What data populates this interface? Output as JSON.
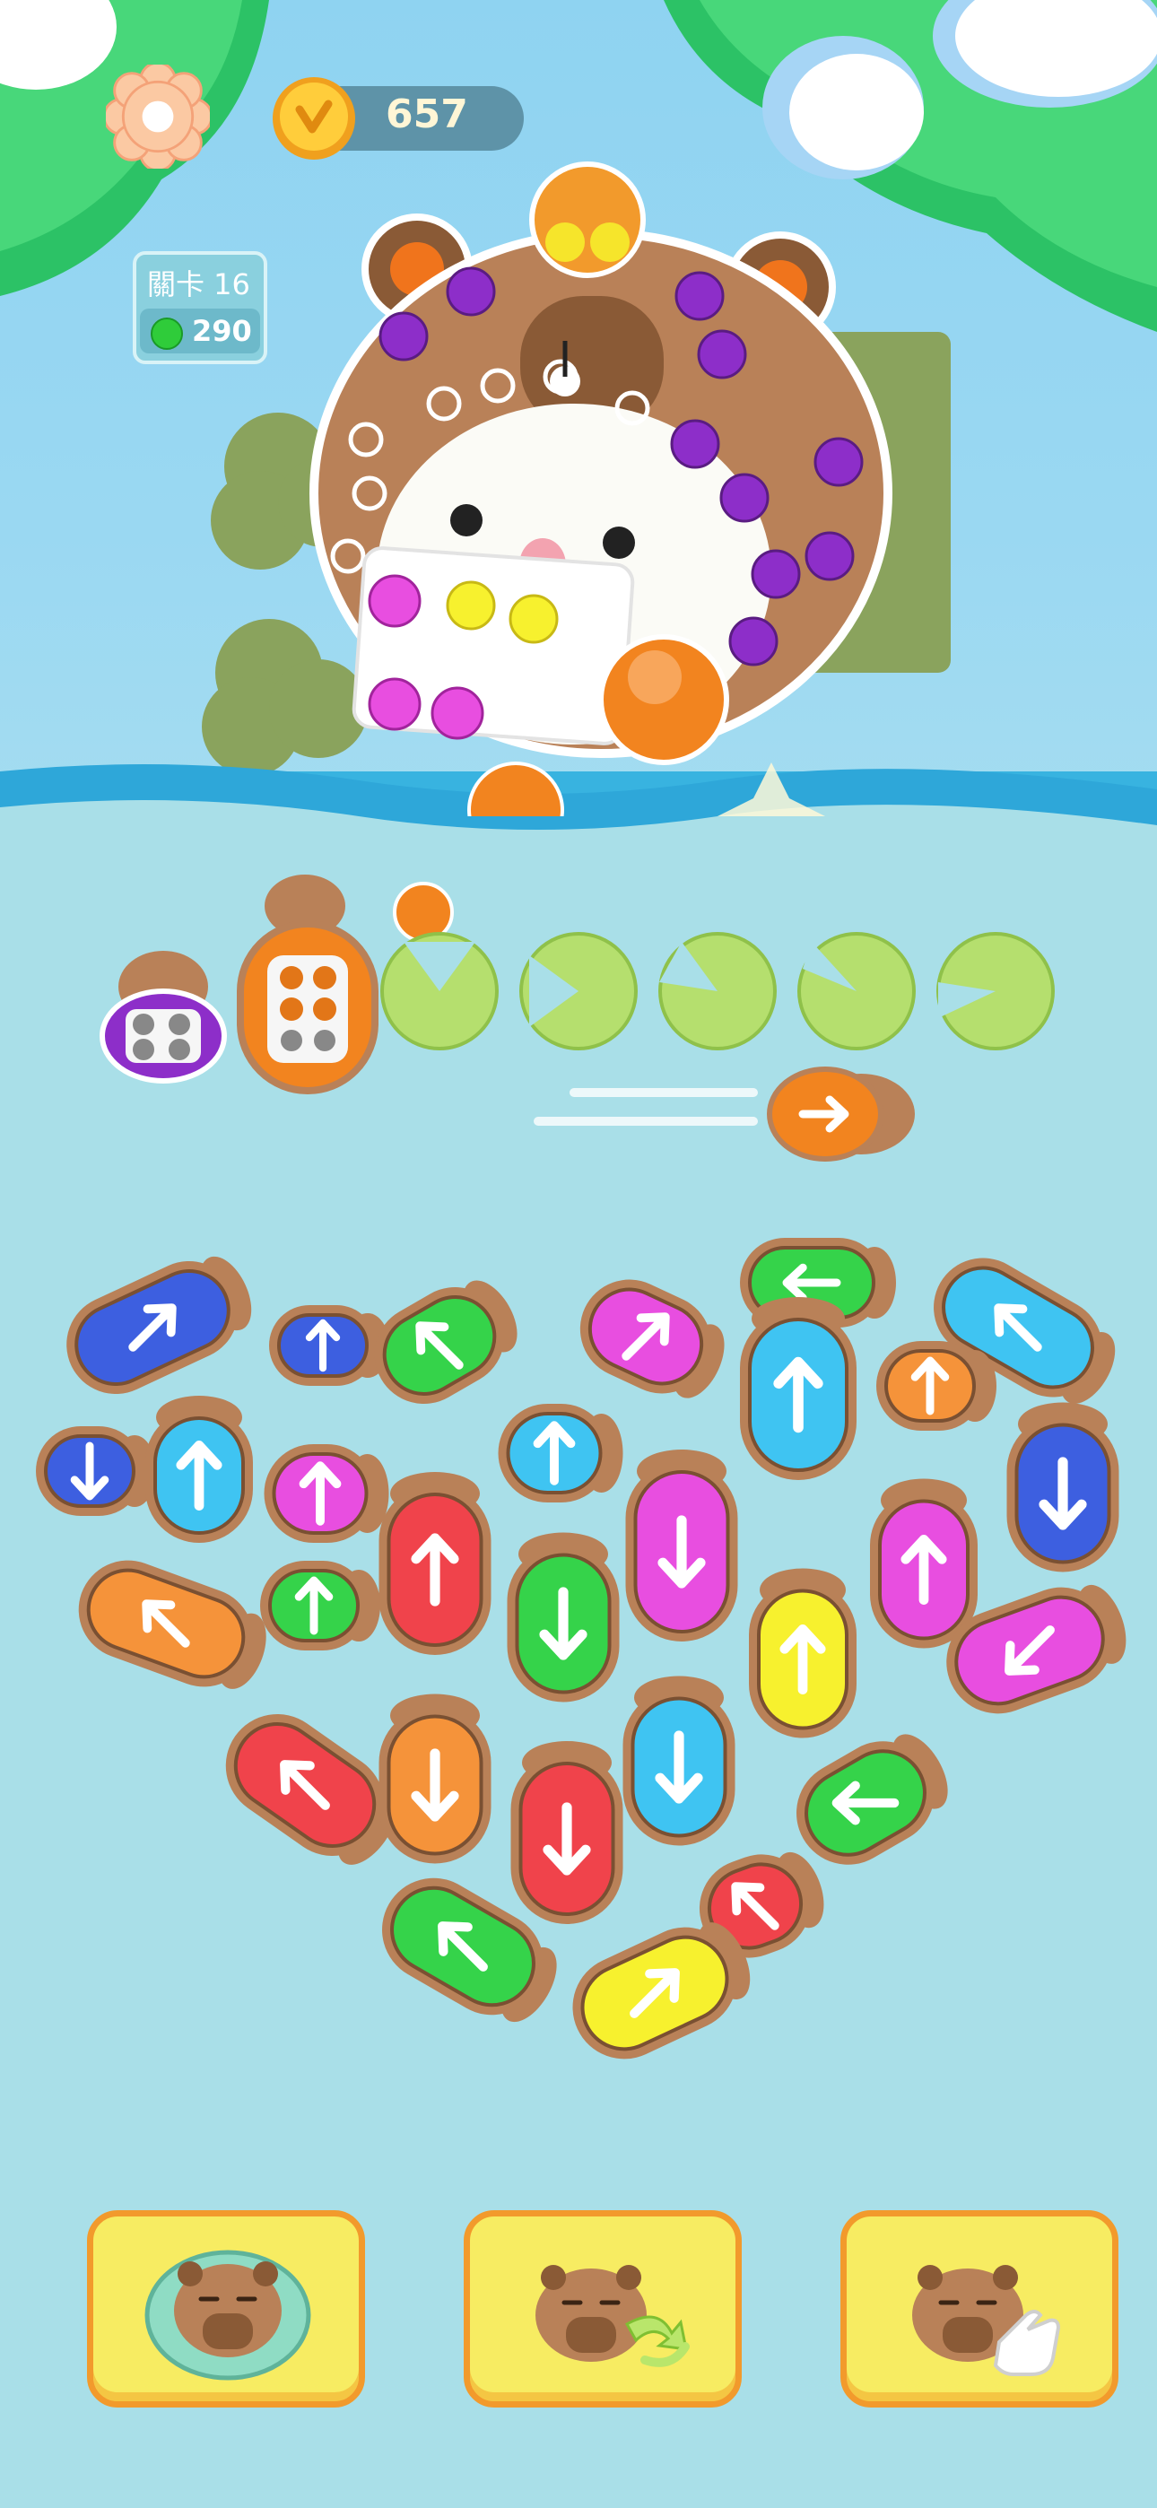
{
  "hud": {
    "coins": "657",
    "level_label": "關卡 16",
    "level_score": "290",
    "settings_icon": "gear-icon",
    "coin_icon": "coin-icon"
  },
  "colors": {
    "sky": "#8fd3f1",
    "pond": "#a9dfe8",
    "water_band": "#38b3e0",
    "blue": "#3d5fe0",
    "green": "#35d34a",
    "cyan": "#3fc4f2",
    "pink": "#e84ee0",
    "orange": "#f5933a",
    "yellow": "#f7f12e",
    "red": "#f0434b",
    "purple": "#9b2fd0",
    "lilypad": "#b5df6e",
    "booster_fill": "#f7ec62",
    "booster_border": "#f29a2c"
  },
  "boosters": [
    {
      "name": "shuffle-booster",
      "icon": "capybara-in-ring-icon"
    },
    {
      "name": "swap-booster",
      "icon": "capybara-arrows-icon"
    },
    {
      "name": "tap-booster",
      "icon": "capybara-hand-icon"
    }
  ],
  "slots": [
    {
      "type": "capybara",
      "color": "purple"
    },
    {
      "type": "capybara",
      "color": "orange"
    },
    {
      "type": "lilypad"
    },
    {
      "type": "lilypad"
    },
    {
      "type": "lilypad"
    },
    {
      "type": "lilypad"
    },
    {
      "type": "lilypad"
    }
  ],
  "board": [
    {
      "color": "blue",
      "dir": "up-right"
    },
    {
      "color": "blue",
      "dir": "up"
    },
    {
      "color": "green",
      "dir": "up-left"
    },
    {
      "color": "pink",
      "dir": "up-right"
    },
    {
      "color": "green",
      "dir": "left"
    },
    {
      "color": "cyan",
      "dir": "up-left"
    },
    {
      "color": "blue",
      "dir": "down"
    },
    {
      "color": "cyan",
      "dir": "up"
    },
    {
      "color": "pink",
      "dir": "up"
    },
    {
      "color": "cyan",
      "dir": "up"
    },
    {
      "color": "cyan",
      "dir": "up"
    },
    {
      "color": "orange",
      "dir": "up"
    },
    {
      "color": "blue",
      "dir": "down"
    },
    {
      "color": "red",
      "dir": "up"
    },
    {
      "color": "green",
      "dir": "up"
    },
    {
      "color": "orange",
      "dir": "up-left"
    },
    {
      "color": "green",
      "dir": "down"
    },
    {
      "color": "pink",
      "dir": "down"
    },
    {
      "color": "pink",
      "dir": "up"
    },
    {
      "color": "yellow",
      "dir": "up"
    },
    {
      "color": "pink",
      "dir": "down-left"
    },
    {
      "color": "red",
      "dir": "up-left"
    },
    {
      "color": "orange",
      "dir": "down"
    },
    {
      "color": "red",
      "dir": "down"
    },
    {
      "color": "cyan",
      "dir": "down"
    },
    {
      "color": "green",
      "dir": "left"
    },
    {
      "color": "red",
      "dir": "up-left"
    },
    {
      "color": "green",
      "dir": "up-left"
    },
    {
      "color": "yellow",
      "dir": "up-right"
    }
  ]
}
